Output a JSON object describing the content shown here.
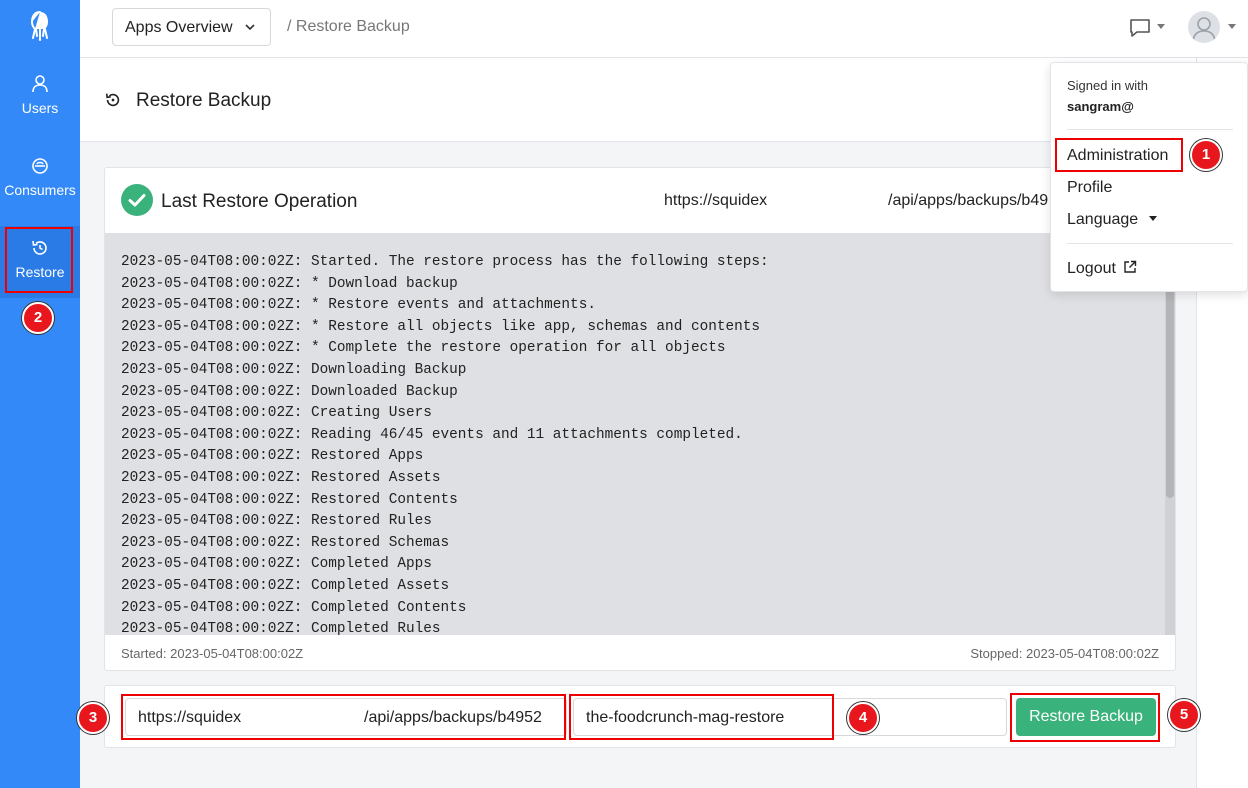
{
  "topbar": {
    "app_select": "Apps Overview",
    "breadcrumb": "/ Restore Backup"
  },
  "sidebar": {
    "items": [
      {
        "label": "Users",
        "icon": "user-icon"
      },
      {
        "label": "Consumers",
        "icon": "consumers-icon"
      },
      {
        "label": "Restore",
        "icon": "restore-icon",
        "active": true
      }
    ]
  },
  "page": {
    "title": "Restore Backup"
  },
  "card": {
    "title": "Last Restore Operation",
    "url_part1": "https://squidex",
    "url_part2": "/api/apps/backups/b49",
    "log": [
      "2023-05-04T08:00:02Z: Started. The restore process has the following steps:",
      "2023-05-04T08:00:02Z: * Download backup",
      "2023-05-04T08:00:02Z: * Restore events and attachments.",
      "2023-05-04T08:00:02Z: * Restore all objects like app, schemas and contents",
      "2023-05-04T08:00:02Z: * Complete the restore operation for all objects",
      "2023-05-04T08:00:02Z: Downloading Backup",
      "2023-05-04T08:00:02Z: Downloaded Backup",
      "2023-05-04T08:00:02Z: Creating Users",
      "2023-05-04T08:00:02Z: Reading 46/45 events and 11 attachments completed.",
      "2023-05-04T08:00:02Z: Restored Apps",
      "2023-05-04T08:00:02Z: Restored Assets",
      "2023-05-04T08:00:02Z: Restored Contents",
      "2023-05-04T08:00:02Z: Restored Rules",
      "2023-05-04T08:00:02Z: Restored Schemas",
      "2023-05-04T08:00:02Z: Completed Apps",
      "2023-05-04T08:00:02Z: Completed Assets",
      "2023-05-04T08:00:02Z: Completed Contents",
      "2023-05-04T08:00:02Z: Completed Rules"
    ],
    "started": "Started: 2023-05-04T08:00:02Z",
    "stopped": "Stopped: 2023-05-04T08:00:02Z"
  },
  "form": {
    "url_value_part1": "https://squidex",
    "url_value_part2": "/api/apps/backups/b4952",
    "name_value": "the-foodcrunch-mag-restore",
    "restore_button": "Restore Backup"
  },
  "dropdown": {
    "signed_in_with": "Signed in with",
    "user": "sangram@",
    "administration": "Administration",
    "profile": "Profile",
    "language": "Language",
    "logout": "Logout"
  },
  "annotations": [
    "1",
    "2",
    "3",
    "4",
    "5"
  ],
  "colors": {
    "sidebar": "#3389f7",
    "success": "#3ab27b",
    "highlight": "#ee0000",
    "badge": "#e8161d"
  }
}
